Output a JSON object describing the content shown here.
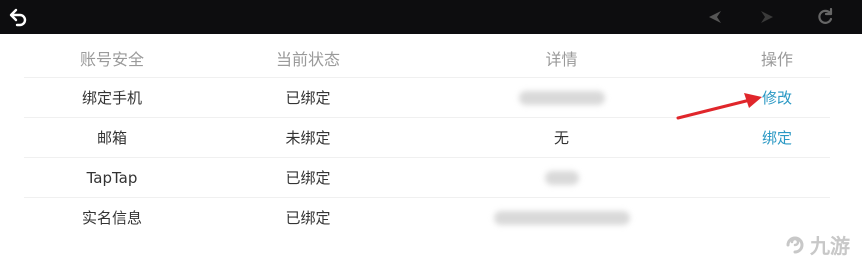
{
  "toolbar": {
    "back_icon": "back-arrow-icon",
    "prev_icon": "nav-prev-icon",
    "next_icon": "nav-next-icon",
    "refresh_icon": "refresh-icon"
  },
  "table": {
    "headers": [
      "账号安全",
      "当前状态",
      "详情",
      "操作"
    ],
    "rows": [
      {
        "item": "绑定手机",
        "status": "已绑定",
        "detail": "",
        "action": "修改"
      },
      {
        "item": "邮箱",
        "status": "未绑定",
        "detail": "无",
        "action": "绑定"
      },
      {
        "item": "TapTap",
        "status": "已绑定",
        "detail": "",
        "action": ""
      },
      {
        "item": "实名信息",
        "status": "已绑定",
        "detail": "",
        "action": ""
      }
    ]
  },
  "colors": {
    "topbar": "#0d0d0f",
    "action": "#2a98c4",
    "annotation_arrow": "#e0262b"
  },
  "watermark": {
    "text": "九游"
  }
}
